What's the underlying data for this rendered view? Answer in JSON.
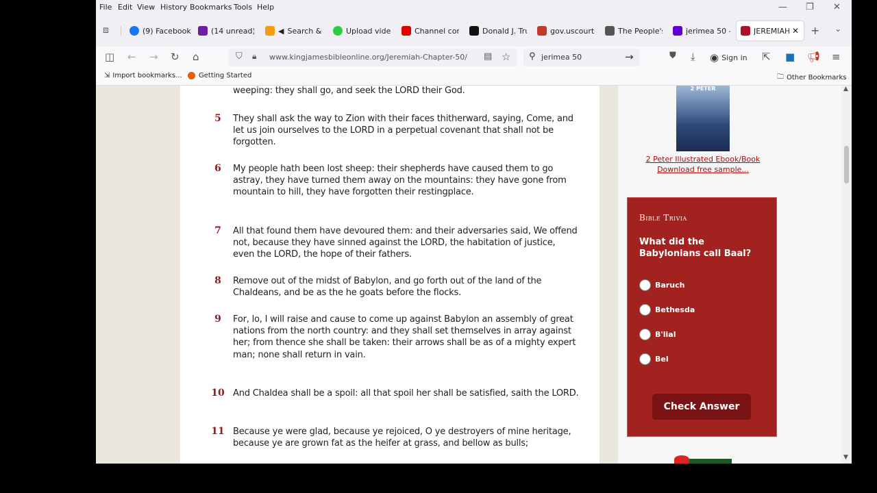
{
  "menu": [
    "File",
    "Edit",
    "View",
    "History",
    "Bookmarks",
    "Tools",
    "Help"
  ],
  "tabs": [
    {
      "label": "(9) Facebook",
      "color": "#1877f2"
    },
    {
      "label": "(14 unread) -",
      "color": "#6e1ea0"
    },
    {
      "label": "Search &",
      "color": "#f39c12"
    },
    {
      "label": "Upload vide",
      "color": "#2ecc40"
    },
    {
      "label": "Channel con",
      "color": "#e00000"
    },
    {
      "label": "Donald J. Tru",
      "color": "#111111"
    },
    {
      "label": "gov.uscourts",
      "color": "#c0392b"
    },
    {
      "label": "The People's",
      "color": "#555555"
    },
    {
      "label": "jerimea 50 -",
      "color": "#6001d2"
    },
    {
      "label": "JEREMIAH",
      "color": "#b0102a"
    }
  ],
  "url": "www.kingjamesbibleonline.org/Jeremiah-Chapter-50/",
  "search_text": "jerimea 50",
  "sign_in": "Sign in",
  "bookmarks": {
    "import": "Import bookmarks...",
    "getting_started": "Getting Started",
    "other": "Other Bookmarks"
  },
  "verses": [
    {
      "num": "",
      "text": "weeping: they shall go, and seek the LORD their God."
    },
    {
      "num": "5",
      "text": "They shall ask the way to Zion with their faces thitherward, saying, Come, and let us join ourselves to the LORD in a perpetual covenant that shall not be forgotten."
    },
    {
      "num": "6",
      "text": "My people hath been lost sheep: their shepherds have caused them to go astray, they have turned them away on the mountains: they have gone from mountain to hill, they have forgotten their restingplace."
    },
    {
      "num": "7",
      "text": "All that found them have devoured them: and their adversaries said, We offend not, because they have sinned against the LORD, the habitation of justice, even the LORD, the hope of their fathers."
    },
    {
      "num": "8",
      "text": "Remove out of the midst of Babylon, and go forth out of the land of the Chaldeans, and be as the he goats before the flocks."
    },
    {
      "num": "9",
      "text": "For, lo, I will raise and cause to come up against Babylon an assembly of great nations from the north country: and they shall set themselves in array against her; from thence she shall be taken: their arrows shall be as of a mighty expert man; none shall return in vain."
    },
    {
      "num": "10",
      "text": "And Chaldea shall be a spoil: all that spoil her shall be satisfied, saith the LORD."
    },
    {
      "num": "11",
      "text": "Because ye were glad, because ye rejoiced, O ye destroyers of mine heritage, because ye are grown fat as the heifer at grass, and bellow as bulls;"
    }
  ],
  "book_promo": {
    "cover_title": "2 PETER",
    "link_line1": "2 Peter Illustrated Ebook/Book",
    "link_line2": "Download free sample..."
  },
  "trivia": {
    "heading": "Bible Trivia",
    "question": "What did the Babylonians call Baal?",
    "options": [
      "Baruch",
      "Bethesda",
      "B'lial",
      "Bel"
    ],
    "button": "Check Answer"
  },
  "colors": {
    "accent": "#a1221f",
    "verse_number": "#8b1d1d",
    "link": "#a01010"
  }
}
